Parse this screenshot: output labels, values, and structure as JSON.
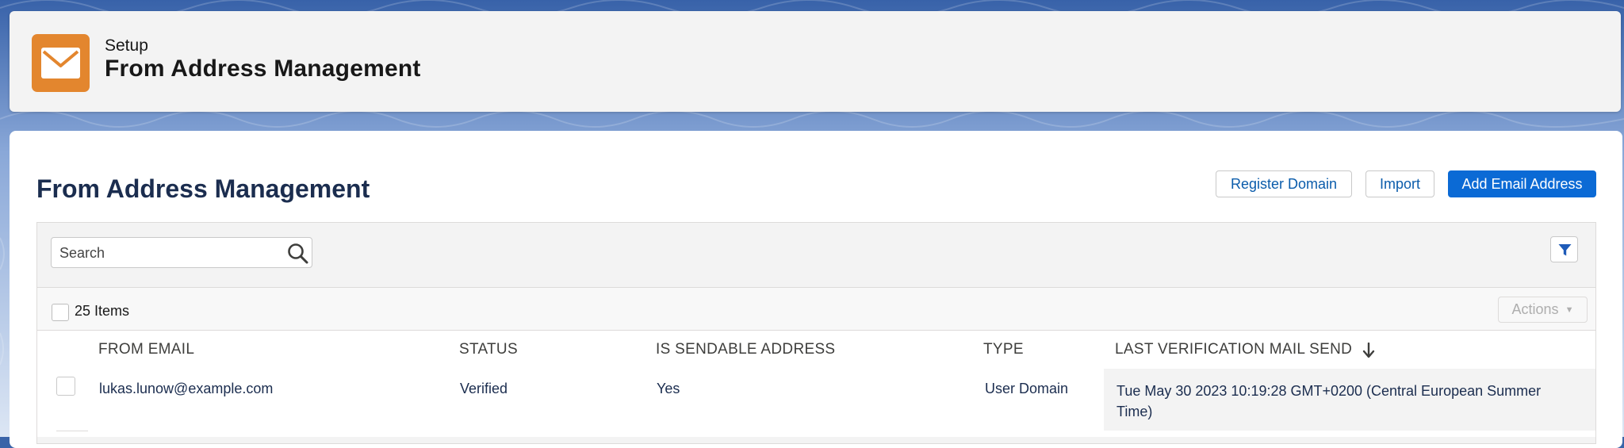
{
  "header": {
    "breadcrumb": "Setup",
    "title": "From Address Management",
    "icon": "envelope-icon",
    "icon_color": "#e3862e"
  },
  "page": {
    "title": "From Address Management",
    "buttons": {
      "register_domain": "Register Domain",
      "import": "Import",
      "add_email": "Add Email Address"
    }
  },
  "search": {
    "placeholder": "Search"
  },
  "list": {
    "item_count": "25 Items",
    "actions_label": "Actions",
    "columns": [
      "FROM EMAIL",
      "STATUS",
      "IS SENDABLE ADDRESS",
      "TYPE",
      "LAST VERIFICATION MAIL SEND"
    ],
    "sorted_column": "LAST VERIFICATION MAIL SEND",
    "sort_direction": "descending",
    "rows": [
      {
        "from_email": "lukas.lunow@example.com",
        "status": "Verified",
        "is_sendable": "Yes",
        "type": "User Domain",
        "last_verification": "Tue May 30 2023 10:19:28 GMT+0200 (Central European Summer Time)"
      }
    ]
  },
  "colors": {
    "brand_blue": "#0b6ad5",
    "background": "#3a64a8",
    "title_text": "#1b2d4f"
  }
}
